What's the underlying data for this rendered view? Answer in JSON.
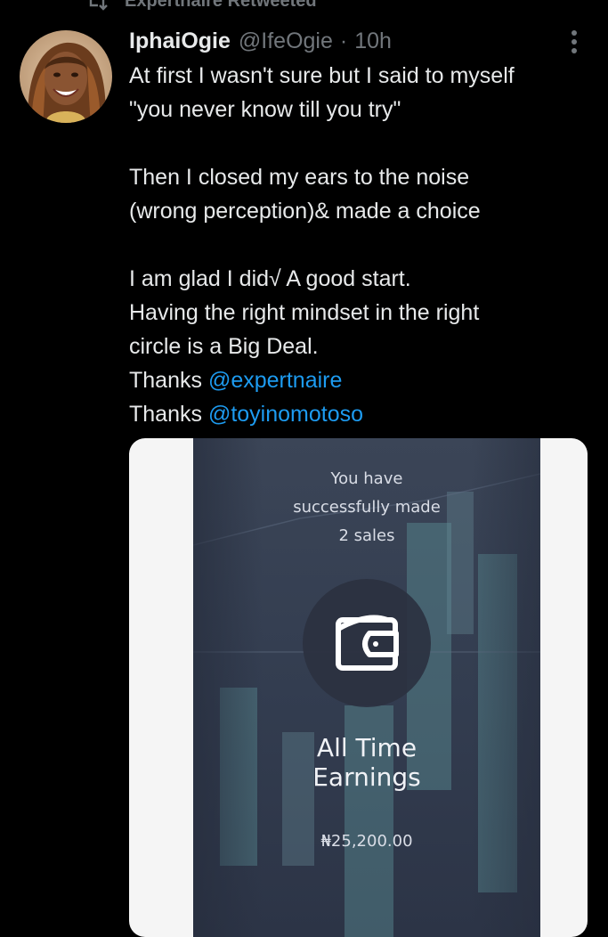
{
  "retweet": {
    "label": "Expertnaire Retweeted"
  },
  "tweet": {
    "display_name": "IphaiOgie",
    "handle": "@IfeOgie",
    "separator": "·",
    "time": "10h",
    "text_lines": [
      "At first I wasn't sure but I said to myself",
      "\"you never know till you try\"",
      "",
      "Then I closed my ears to the noise",
      "(wrong perception)& made a choice",
      "",
      "I am glad I did√  A good start.",
      "Having the right mindset in the right",
      "circle is a Big Deal."
    ],
    "thanks_1": {
      "prefix": "Thanks ",
      "mention": "@expertnaire"
    },
    "thanks_2": {
      "prefix": "Thanks ",
      "mention": "@toyinomotoso"
    }
  },
  "media": {
    "sales_lines": [
      "You have",
      "successfully made",
      "2 sales"
    ],
    "earnings_lines": [
      "All Time",
      "Earnings"
    ],
    "amount": "₦25,200.00",
    "icon": "wallet-icon"
  },
  "colors": {
    "background": "#000000",
    "text": "#e7e9ea",
    "muted": "#71767b",
    "link": "#1d9bf0"
  }
}
